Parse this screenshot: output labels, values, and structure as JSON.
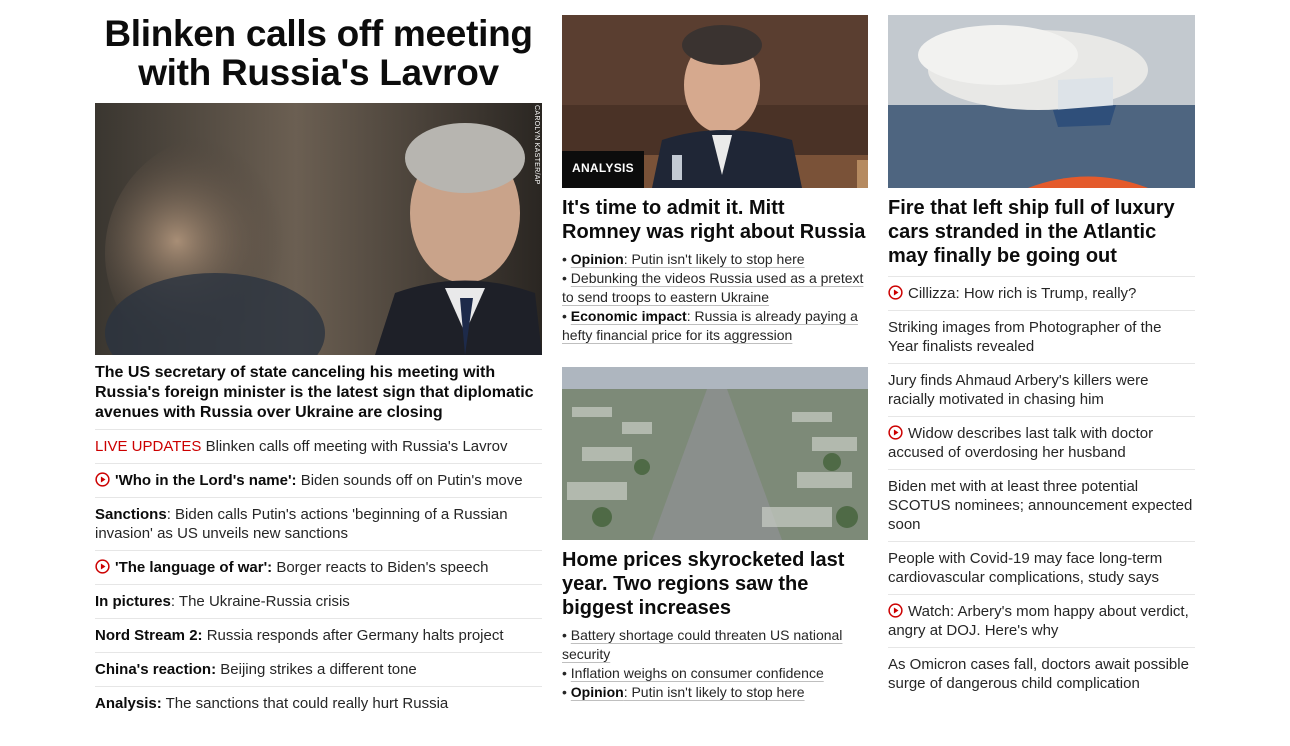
{
  "lead": {
    "headline": "Blinken calls off meeting with Russia's Lavrov",
    "photo_credit": "CAROLYN KASTER/AP",
    "description": "The US secretary of state canceling his meeting with Russia's foreign minister is the latest sign that diplomatic avenues with Russia over Ukraine are closing",
    "items": [
      {
        "prefix": "LIVE UPDATES",
        "text": " Blinken calls off meeting with Russia's Lavrov"
      },
      {
        "bold": "'Who in the Lord's name':",
        "text": " Biden sounds off on Putin's move"
      },
      {
        "bold": "Sanctions",
        "text": ": Biden calls Putin's actions 'beginning of a Russian invasion' as US unveils new sanctions"
      },
      {
        "bold": "'The language of war':",
        "text": " Borger reacts to Biden's speech"
      },
      {
        "bold": "In pictures",
        "text": ": The Ukraine-Russia crisis"
      },
      {
        "bold": "Nord Stream 2:",
        "text": " Russia responds after Germany halts project"
      },
      {
        "bold": "China's reaction:",
        "text": " Beijing strikes a different tone"
      },
      {
        "bold": "Analysis:",
        "text": " The sanctions that could really hurt Russia"
      }
    ]
  },
  "romney": {
    "badge": "ANALYSIS",
    "title": "It's time to admit it. Mitt Romney was right about Russia",
    "bullets": [
      {
        "bold": "Opinion",
        "text": ": Putin isn't likely to stop here"
      },
      {
        "bold": "",
        "text": "Debunking the videos Russia used as a pretext to send troops to eastern Ukraine"
      },
      {
        "bold": "Economic impact",
        "text": ": Russia is already paying a hefty financial price for its aggression"
      }
    ]
  },
  "homes": {
    "title": "Home prices skyrocketed last year. Two regions saw the biggest increases",
    "bullets": [
      {
        "bold": "",
        "text": "Battery shortage could threaten US national security"
      },
      {
        "bold": "",
        "text": "Inflation weighs on consumer confidence"
      },
      {
        "bold": "Opinion",
        "text": ": Putin isn't likely to stop here"
      }
    ]
  },
  "ship": {
    "title": "Fire that left ship full of luxury cars stranded in the Atlantic may finally be going out",
    "items": [
      {
        "text": "Cillizza: How rich is Trump, really?"
      },
      {
        "text": "Striking images from Photographer of the Year finalists revealed"
      },
      {
        "text": "Jury finds Ahmaud Arbery's killers were racially motivated in chasing him"
      },
      {
        "text": "Widow describes last talk with doctor accused of overdosing her husband"
      },
      {
        "text": "Biden met with at least three potential SCOTUS nominees; announcement expected soon"
      },
      {
        "text": "People with Covid-19 may face long-term cardiovascular complications, study says"
      },
      {
        "text": "Watch: Arbery's mom happy about verdict, angry at DOJ. Here's why"
      },
      {
        "text": "As Omicron cases fall, doctors await possible surge of dangerous child complication"
      }
    ]
  },
  "colors": {
    "live": "#cc0000",
    "play": "#cc0000",
    "text": "#0c0c0c"
  }
}
